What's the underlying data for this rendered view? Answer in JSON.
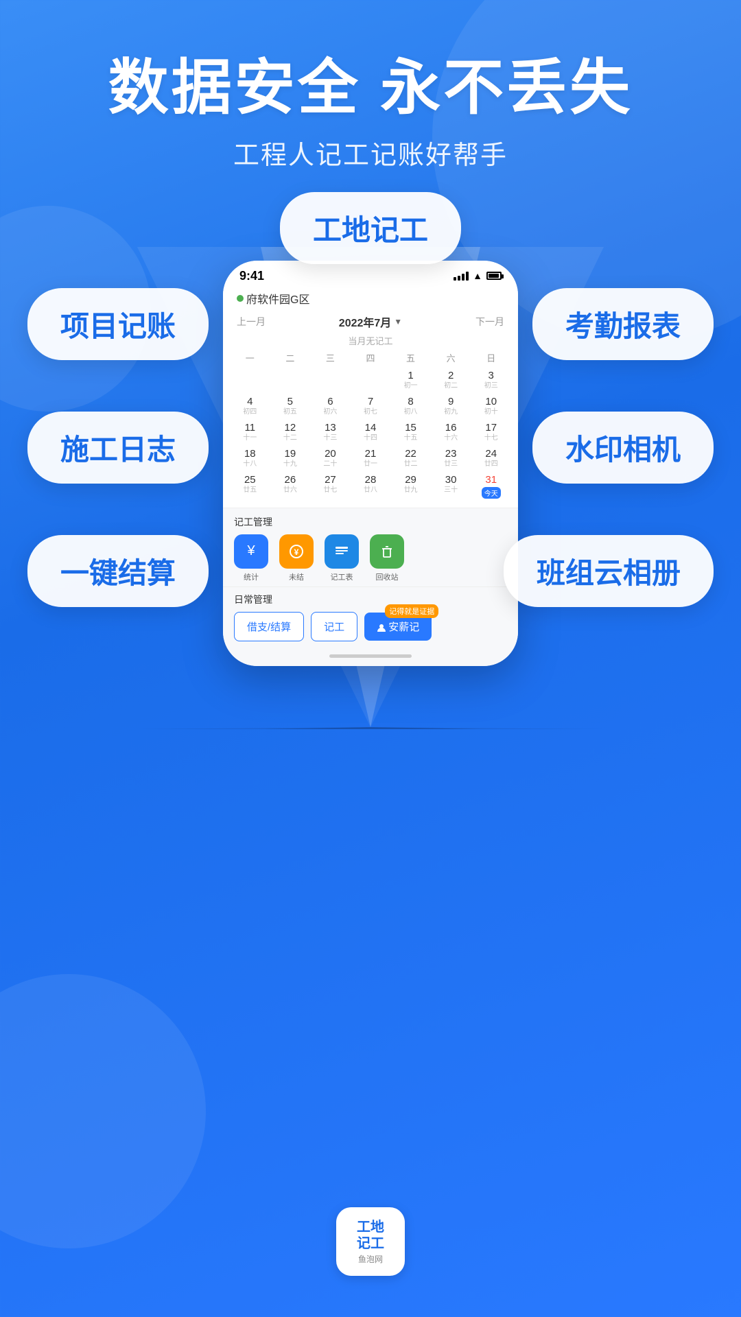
{
  "header": {
    "title": "数据安全 永不丢失",
    "subtitle": "工程人记工记账好帮手"
  },
  "features": [
    {
      "id": "gongdi",
      "label": "工地记工",
      "position": "top"
    },
    {
      "id": "xiangmu",
      "label": "项目记账",
      "position": "left1"
    },
    {
      "id": "kaoqin",
      "label": "考勤报表",
      "position": "right1"
    },
    {
      "id": "shigong",
      "label": "施工日志",
      "position": "left2"
    },
    {
      "id": "shuiyin",
      "label": "水印相机",
      "position": "right2"
    },
    {
      "id": "yijie",
      "label": "一键结算",
      "position": "left3"
    },
    {
      "id": "banzuyun",
      "label": "班组云相册",
      "position": "right3"
    }
  ],
  "phone": {
    "status_time": "9:41",
    "location": "府软件园G区",
    "calendar": {
      "prev_label": "上一月",
      "next_label": "下一月",
      "month_label": "2022年7月",
      "no_record": "当月无记工",
      "weekdays": [
        "一",
        "二",
        "三",
        "四",
        "五",
        "六",
        "日"
      ],
      "days": [
        {
          "num": "",
          "lunar": ""
        },
        {
          "num": "",
          "lunar": ""
        },
        {
          "num": "",
          "lunar": ""
        },
        {
          "num": "",
          "lunar": ""
        },
        {
          "num": "1",
          "lunar": "初一"
        },
        {
          "num": "2",
          "lunar": "初二"
        },
        {
          "num": "3",
          "lunar": "初三"
        },
        {
          "num": "4",
          "lunar": "初四"
        },
        {
          "num": "5",
          "lunar": "初五"
        },
        {
          "num": "6",
          "lunar": "初六"
        },
        {
          "num": "7",
          "lunar": "初七"
        },
        {
          "num": "8",
          "lunar": "初八"
        },
        {
          "num": "9",
          "lunar": "初九"
        },
        {
          "num": "10",
          "lunar": "初十"
        },
        {
          "num": "11",
          "lunar": "十一"
        },
        {
          "num": "12",
          "lunar": "十二"
        },
        {
          "num": "13",
          "lunar": "十三"
        },
        {
          "num": "14",
          "lunar": "十四"
        },
        {
          "num": "15",
          "lunar": "十五"
        },
        {
          "num": "16",
          "lunar": "十六"
        },
        {
          "num": "17",
          "lunar": "十七"
        },
        {
          "num": "18",
          "lunar": "十八"
        },
        {
          "num": "19",
          "lunar": "十九"
        },
        {
          "num": "20",
          "lunar": "二十"
        },
        {
          "num": "21",
          "lunar": "廿一"
        },
        {
          "num": "22",
          "lunar": "廿二"
        },
        {
          "num": "23",
          "lunar": "廿三"
        },
        {
          "num": "24",
          "lunar": "廿四"
        },
        {
          "num": "25",
          "lunar": "廿五"
        },
        {
          "num": "26",
          "lunar": "廿六"
        },
        {
          "num": "27",
          "lunar": "廿七"
        },
        {
          "num": "28",
          "lunar": "廿八"
        },
        {
          "num": "29",
          "lunar": "廿九"
        },
        {
          "num": "30",
          "lunar": "三十"
        },
        {
          "num": "31",
          "lunar": "今天",
          "today": true
        }
      ]
    },
    "manage": {
      "section_title": "记工管理",
      "items": [
        {
          "label": "统计",
          "icon": "¥",
          "color": "icon-blue"
        },
        {
          "label": "未结",
          "icon": "🔔",
          "color": "icon-orange"
        },
        {
          "label": "记工表",
          "icon": "📋",
          "color": "icon-blue2"
        },
        {
          "label": "回收站",
          "icon": "🗑",
          "color": "icon-green"
        }
      ]
    },
    "daily": {
      "section_title": "日常管理",
      "buttons": [
        {
          "label": "借支/结算",
          "type": "outline"
        },
        {
          "label": "记工",
          "type": "outline"
        },
        {
          "label": "安薪记",
          "type": "filled",
          "badge": "记得就是证据"
        }
      ]
    }
  },
  "logo": {
    "main": "工地\n记工",
    "sub": "鱼泡网"
  }
}
